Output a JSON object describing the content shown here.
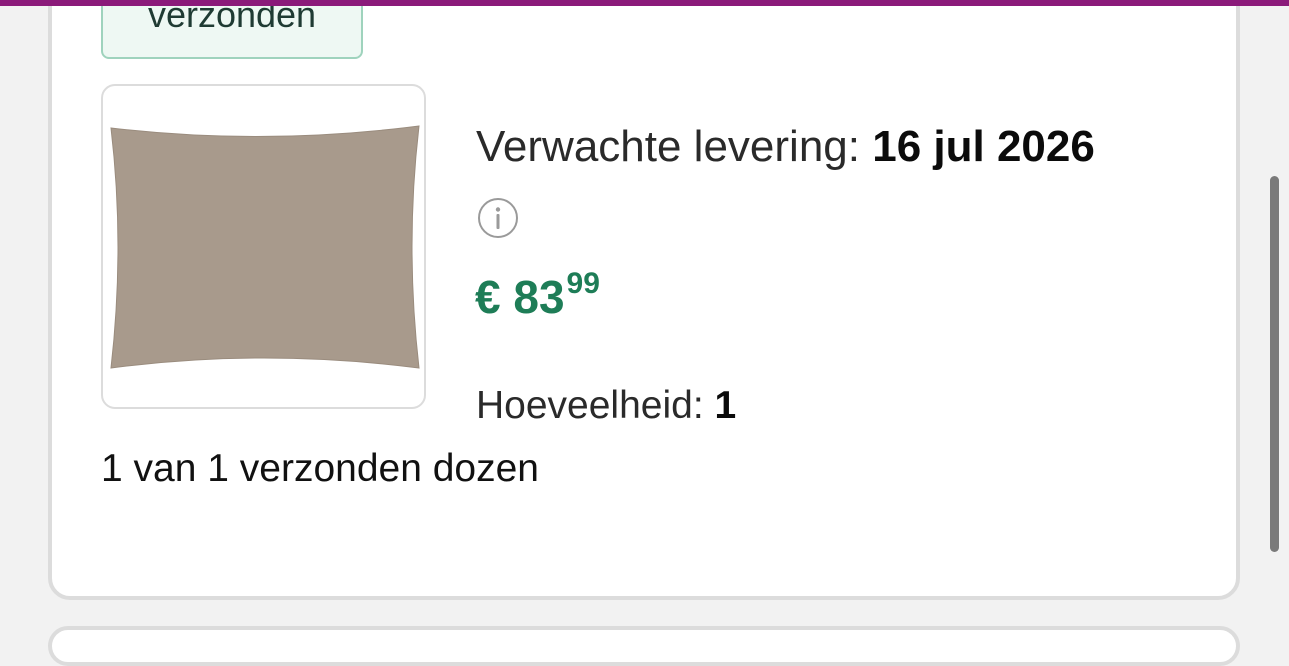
{
  "order": {
    "status_badge": "verzonden",
    "delivery_label": "Verwachte levering:",
    "delivery_date": "16 jul 2026",
    "info_icon": "info-icon",
    "price": {
      "main": "€ 83",
      "cents": "99"
    },
    "quantity_label": "Hoeveelheid:",
    "quantity_value": "1",
    "boxes_text": "1 van 1 verzonden dozen",
    "product_image_alt": "product-image",
    "product_color": "#a89a8c"
  },
  "colors": {
    "accent_bar": "#8b1a7a",
    "price_green": "#1e7d57",
    "badge_bg": "#eef8f3",
    "badge_border": "#9fd3bd"
  }
}
